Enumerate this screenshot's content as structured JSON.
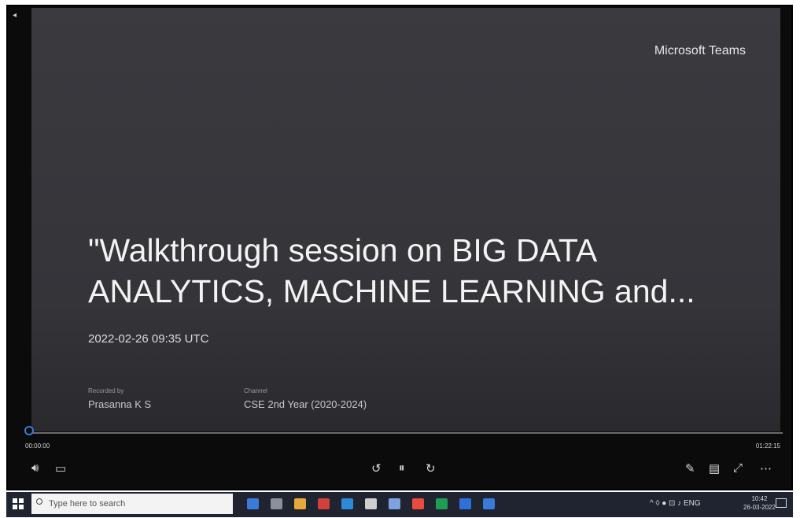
{
  "window": {
    "back_icon": "◂",
    "min": "–",
    "max": "□",
    "close": "✕"
  },
  "slide": {
    "brand": "Microsoft Teams",
    "title": "\"Walkthrough session on BIG DATA ANALYTICS, MACHINE LEARNING and...",
    "date": "2022-02-26 09:35 UTC",
    "recorded_by_label": "Recorded by",
    "recorded_by": "Prasanna K S",
    "channel_label": "Channel",
    "channel": "CSE 2nd Year (2020-2024)"
  },
  "player": {
    "elapsed": "00:00:00",
    "total": "01:22:15",
    "progress": 0.0,
    "icons": [
      "volume-icon",
      "captions-icon",
      "rewind-icon",
      "pause-icon",
      "forward-icon",
      "pen-icon",
      "settings-icon",
      "fullscreen-icon",
      "more-icon"
    ]
  },
  "taskbar": {
    "search_placeholder": "Type here to search",
    "tray": "^ ◊ ● ⊡ ♪ ENG",
    "time": "10:42",
    "date": "26-03-2022",
    "app_colors": [
      "#3a7ad9",
      "#8a8f99",
      "#e6a93a",
      "#d1403a",
      "#2e8ad8",
      "#cfcfcf",
      "#7ea2e0",
      "#e84c3d",
      "#1f9d55",
      "#2f6fd9",
      "#3a7ad9"
    ]
  }
}
